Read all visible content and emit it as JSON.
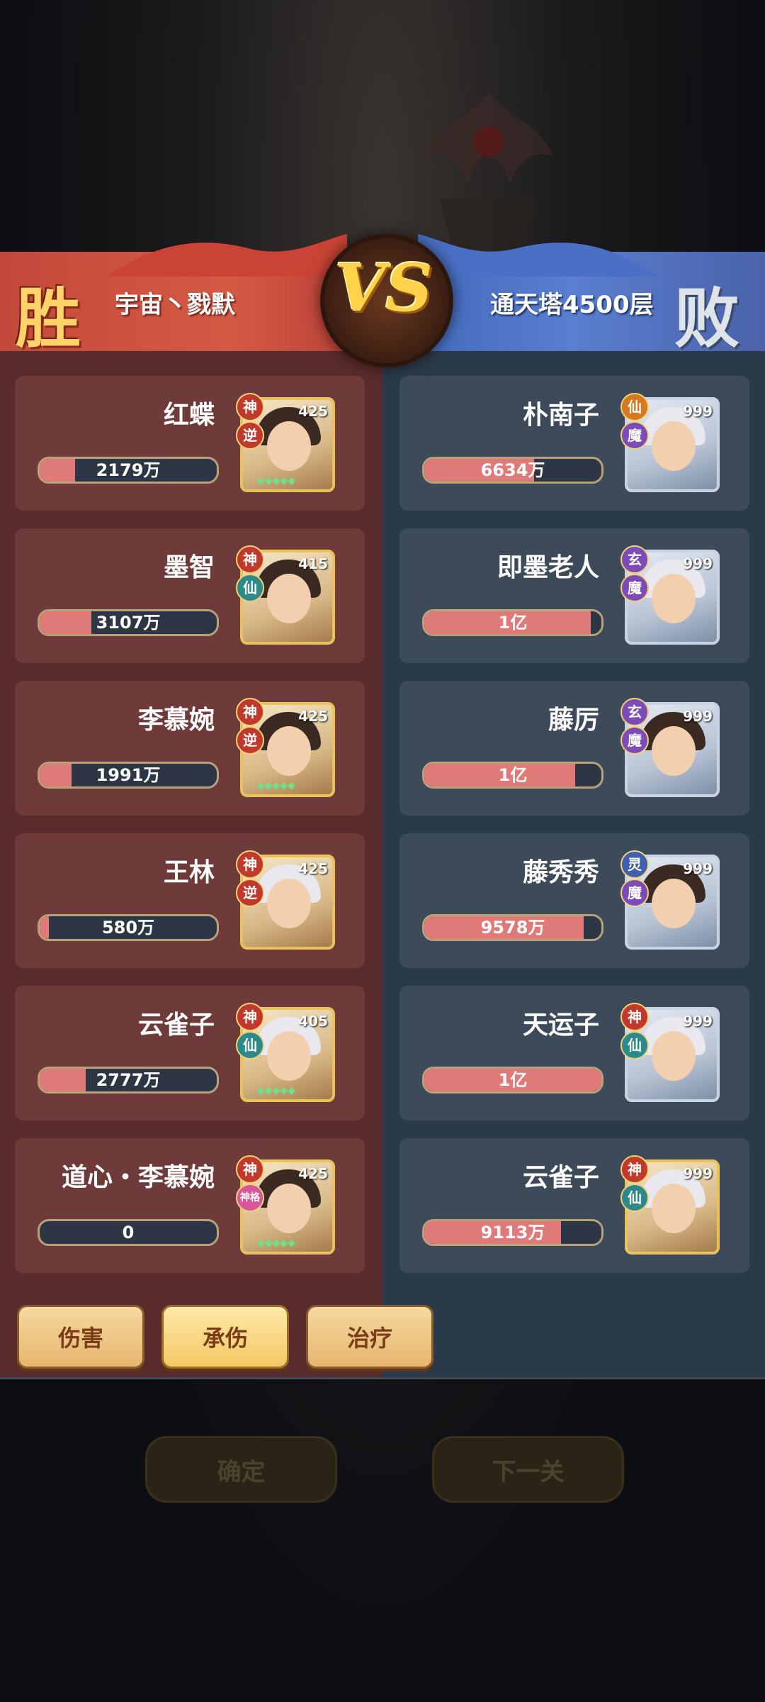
{
  "header": {
    "win_label": "胜",
    "lose_label": "败",
    "vs_label": "VS",
    "left_team": "宇宙丶戮默",
    "right_team": "通天塔4500层"
  },
  "left_units": [
    {
      "name": "红蝶",
      "level": "425",
      "badges": [
        "神",
        "逆"
      ],
      "value": "2179万",
      "ratio": 0.2,
      "color": "red"
    },
    {
      "name": "墨智",
      "level": "415",
      "badges": [
        "神",
        "仙"
      ],
      "value": "3107万",
      "ratio": 0.29,
      "color": "red"
    },
    {
      "name": "李慕婉",
      "level": "425",
      "badges": [
        "神",
        "逆"
      ],
      "value": "1991万",
      "ratio": 0.18,
      "color": "red"
    },
    {
      "name": "王林",
      "level": "425",
      "badges": [
        "神",
        "逆"
      ],
      "value": "580万",
      "ratio": 0.05,
      "color": "red"
    },
    {
      "name": "云雀子",
      "level": "405",
      "badges": [
        "神",
        "仙"
      ],
      "value": "2777万",
      "ratio": 0.26,
      "color": "red"
    },
    {
      "name": "道心・李慕婉",
      "level": "425",
      "badges": [
        "神",
        "神格"
      ],
      "value": "0",
      "ratio": 0.0,
      "color": "red"
    }
  ],
  "right_units": [
    {
      "name": "朴南子",
      "level": "999",
      "badges": [
        "仙",
        "魔"
      ],
      "value": "6634万",
      "ratio": 0.62
    },
    {
      "name": "即墨老人",
      "level": "999",
      "badges": [
        "玄",
        "魔"
      ],
      "value": "1亿",
      "ratio": 0.94
    },
    {
      "name": "藤厉",
      "level": "999",
      "badges": [
        "玄",
        "魔"
      ],
      "value": "1亿",
      "ratio": 0.85
    },
    {
      "name": "藤秀秀",
      "level": "999",
      "badges": [
        "灵",
        "魔"
      ],
      "value": "9578万",
      "ratio": 0.9
    },
    {
      "name": "天运子",
      "level": "999",
      "badges": [
        "神",
        "仙"
      ],
      "value": "1亿",
      "ratio": 1.0
    },
    {
      "name": "云雀子",
      "level": "999",
      "badges": [
        "神",
        "仙"
      ],
      "value": "9113万",
      "ratio": 0.77
    }
  ],
  "tabs": [
    {
      "label": "伤害",
      "active": false
    },
    {
      "label": "承伤",
      "active": true
    },
    {
      "label": "治疗",
      "active": false
    }
  ],
  "background_buttons": {
    "confirm": "确定",
    "next": "下一关"
  }
}
